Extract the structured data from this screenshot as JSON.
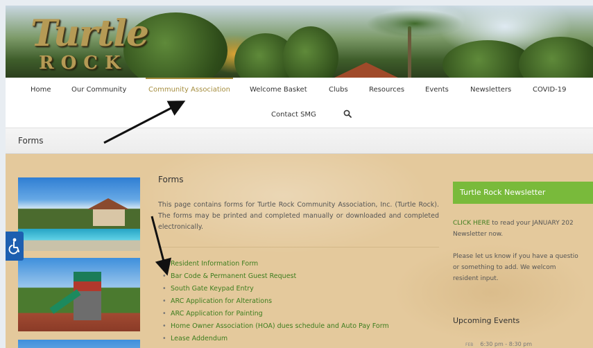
{
  "header": {
    "logo_line1": "Turtle",
    "logo_line2": "ROCK"
  },
  "nav": {
    "items": [
      {
        "label": "Home"
      },
      {
        "label": "Our Community"
      },
      {
        "label": "Community Association",
        "active": true
      },
      {
        "label": "Welcome Basket"
      },
      {
        "label": "Clubs"
      },
      {
        "label": "Resources"
      },
      {
        "label": "Events"
      },
      {
        "label": "Newsletters"
      },
      {
        "label": "COVID-19"
      },
      {
        "label": "Contact SMG"
      }
    ],
    "search_icon": "search-icon",
    "active_color": "#a58d3e"
  },
  "page": {
    "title": "Forms"
  },
  "main": {
    "heading": "Forms",
    "intro": "This page contains forms for Turtle Rock Community Association, Inc. (Turtle Rock). The forms may be printed and completed manually or downloaded and completed electronically.",
    "forms": [
      "Resident Information Form",
      "Bar Code & Permanent Guest Request",
      "South Gate Keypad Entry",
      "ARC Application for Alterations",
      "ARC Application for Painting",
      "Home Owner Association (HOA) dues schedule and Auto Pay Form",
      "Lease Addendum"
    ],
    "link_color": "#3d7d1e"
  },
  "sidebar": {
    "newsletter_heading": "Turtle Rock Newsletter",
    "newsletter_link": "CLICK HERE",
    "newsletter_text_after_link": " to read your JANUARY 202",
    "newsletter_text_line2": "Newsletter now.",
    "feedback_line1": "Please let us know if you have a questio",
    "feedback_line2": "or  something  to  add.  We  welcom",
    "feedback_line3": "resident input.",
    "upcoming_heading": "Upcoming Events",
    "event_month": "FEB",
    "event_time": "6:30 pm - 8:30 pm",
    "heading_color": "#79ba3b"
  },
  "accessibility": {
    "icon": "accessibility-icon",
    "color": "#1d5fb0"
  }
}
